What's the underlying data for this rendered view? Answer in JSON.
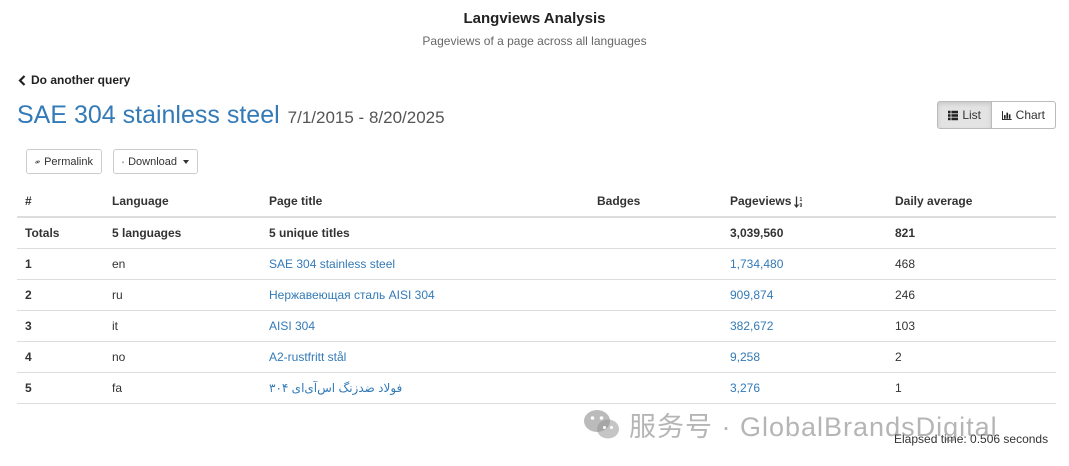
{
  "app": {
    "title": "Langviews Analysis",
    "subtitle": "Pageviews of a page across all languages"
  },
  "nav": {
    "back_label": "Do another query"
  },
  "page": {
    "article": "SAE 304 stainless steel",
    "date_range": "7/1/2015 - 8/20/2025"
  },
  "view_toggle": {
    "list_label": "List",
    "chart_label": "Chart",
    "active": "List"
  },
  "toolbar": {
    "permalink_label": "Permalink",
    "download_label": "Download"
  },
  "table": {
    "headers": [
      "#",
      "Language",
      "Page title",
      "Badges",
      "Pageviews",
      "Daily average"
    ],
    "totals": {
      "label": "Totals",
      "languages": "5 languages",
      "titles": "5 unique titles",
      "badges": "",
      "pageviews": "3,039,560",
      "daily_average": "821"
    },
    "rows": [
      {
        "num": "1",
        "lang": "en",
        "title": "SAE 304 stainless steel",
        "badges": "",
        "pageviews": "1,734,480",
        "daily_average": "468"
      },
      {
        "num": "2",
        "lang": "ru",
        "title": "Нержавеющая сталь AISI 304",
        "badges": "",
        "pageviews": "909,874",
        "daily_average": "246"
      },
      {
        "num": "3",
        "lang": "it",
        "title": "AISI 304",
        "badges": "",
        "pageviews": "382,672",
        "daily_average": "103"
      },
      {
        "num": "4",
        "lang": "no",
        "title": "A2-rustfritt stål",
        "badges": "",
        "pageviews": "9,258",
        "daily_average": "2"
      },
      {
        "num": "5",
        "lang": "fa",
        "title": "فولاد ضدزنگ اس‌آی‌ای ۳۰۴",
        "badges": "",
        "pageviews": "3,276",
        "daily_average": "1"
      }
    ]
  },
  "footer": {
    "elapsed": "Elapsed time: 0.506 seconds"
  },
  "watermark": {
    "text": "服务号 · GlobalBrandsDigital"
  },
  "colors": {
    "link": "#337ab7",
    "border": "#dddddd",
    "active_button": "#e3e3e3"
  }
}
